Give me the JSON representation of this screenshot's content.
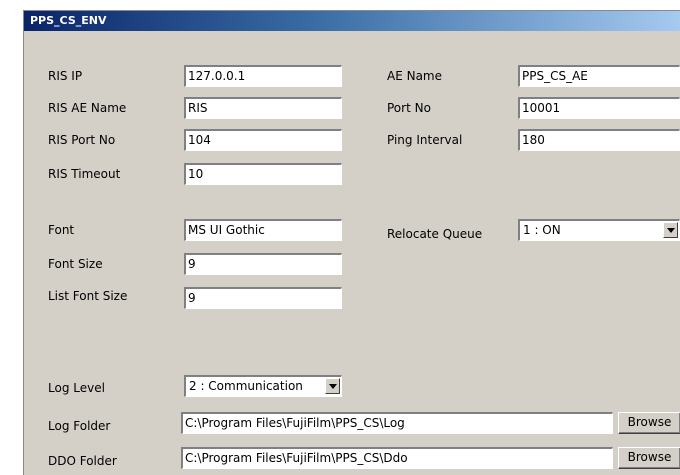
{
  "window": {
    "title": "PPS_CS_ENV"
  },
  "fields": {
    "ris_ip": {
      "label": "RIS IP",
      "value": "127.0.0.1"
    },
    "ris_ae_name": {
      "label": "RIS AE Name",
      "value": "RIS"
    },
    "ris_port_no": {
      "label": "RIS Port No",
      "value": "104"
    },
    "ris_timeout": {
      "label": "RIS Timeout",
      "value": "10"
    },
    "ae_name": {
      "label": "AE Name",
      "value": "PPS_CS_AE"
    },
    "port_no": {
      "label": "Port No",
      "value": "10001"
    },
    "ping_interval": {
      "label": "Ping Interval",
      "value": "180"
    },
    "font": {
      "label": "Font",
      "value": "MS UI Gothic"
    },
    "font_size": {
      "label": "Font Size",
      "value": "9"
    },
    "list_font_size": {
      "label": "List Font Size",
      "value": "9"
    },
    "relocate_queue": {
      "label": "Relocate Queue",
      "value": "1 : ON"
    },
    "log_level": {
      "label": "Log Level",
      "value": "2 : Communication"
    },
    "log_folder": {
      "label": "Log Folder",
      "value": "C:\\Program Files\\FujiFilm\\PPS_CS\\Log",
      "browse_label": "Browse"
    },
    "ddo_folder": {
      "label": "DDO Folder",
      "value": "C:\\Program Files\\FujiFilm\\PPS_CS\\Ddo",
      "browse_label": "Browse"
    }
  },
  "icons": {
    "dropdown": "chevron-down-icon"
  },
  "colors": {
    "title_bar_start": "#0a246a",
    "title_bar_end": "#a6caf0",
    "dialog_bg": "#d4d0c8"
  }
}
